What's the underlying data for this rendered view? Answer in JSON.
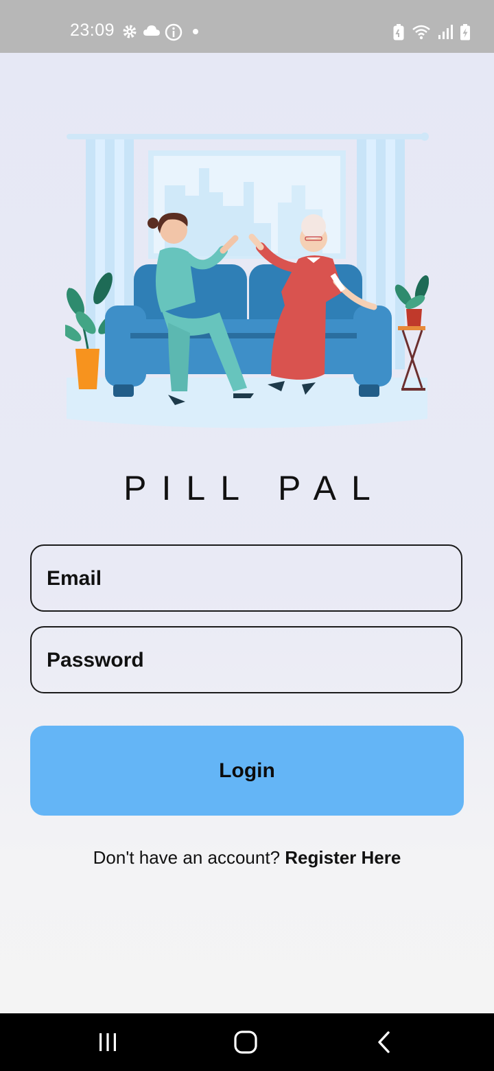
{
  "status_bar": {
    "time": "23:09",
    "left_icons": [
      "gear-icon",
      "cloud-icon",
      "info-icon",
      "dot-icon"
    ],
    "right_icons": [
      "battery-saver-icon",
      "wifi-icon",
      "signal-icon",
      "battery-charging-icon"
    ]
  },
  "app": {
    "title": "PILL PAL"
  },
  "form": {
    "email_placeholder": "Email",
    "email_value": "",
    "password_placeholder": "Password",
    "password_value": "",
    "login_label": "Login"
  },
  "register": {
    "prompt": "Don't have an account? ",
    "link": "Register Here"
  },
  "nav": [
    "recents-icon",
    "home-icon",
    "back-icon"
  ],
  "colors": {
    "accent": "#64b5f6",
    "status_bar": "#b7b7b7"
  }
}
